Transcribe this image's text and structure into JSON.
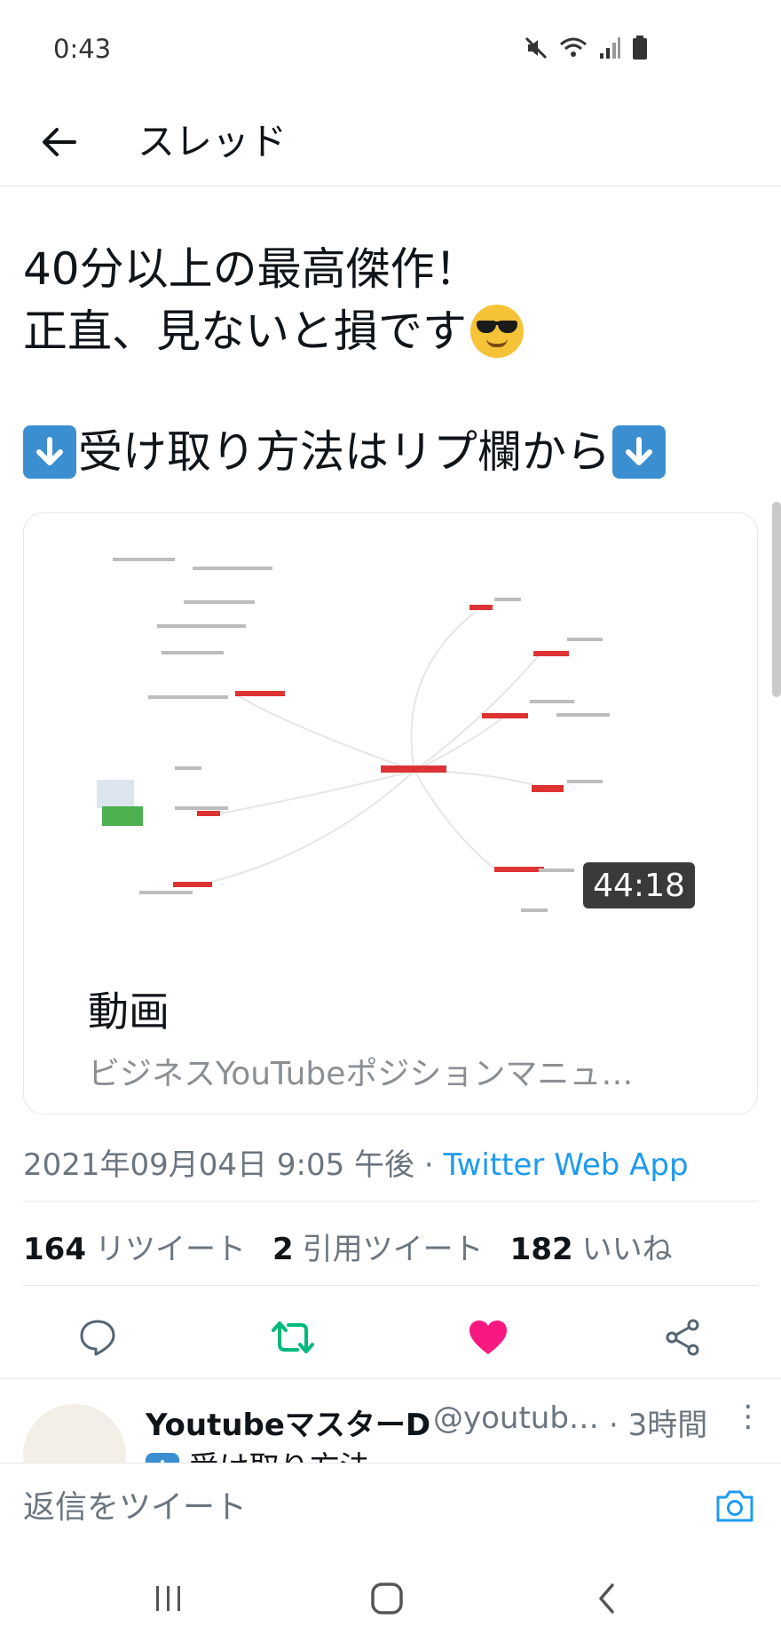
{
  "status_bar": {
    "time": "0:43"
  },
  "nav": {
    "title": "スレッド"
  },
  "tweet": {
    "line1": "40分以上の最高傑作！",
    "line2": "正直、見ないと損です",
    "line3": "受け取り方法はリプ欄から"
  },
  "media": {
    "duration": "44:18",
    "title": "動画",
    "subtitle": "ビジネスYouTubeポジションマニュ…"
  },
  "meta": {
    "datetime": "2021年09月04日 9:05 午後 · ",
    "source": "Twitter Web App"
  },
  "stats": {
    "retweets_count": "164",
    "retweets_label": "リツイート",
    "quotes_count": "2",
    "quotes_label": "引用ツイート",
    "likes_count": "182",
    "likes_label": "いいね"
  },
  "colors": {
    "accent": "#1d9bf0",
    "retweet": "#00ba7c",
    "like": "#f91880"
  },
  "reply": {
    "name": "YoutubeマスターD",
    "handle": "@youtub…",
    "time": "· 3時間",
    "snippet": "受け取り方法"
  },
  "compose": {
    "placeholder": "返信をツイート"
  }
}
